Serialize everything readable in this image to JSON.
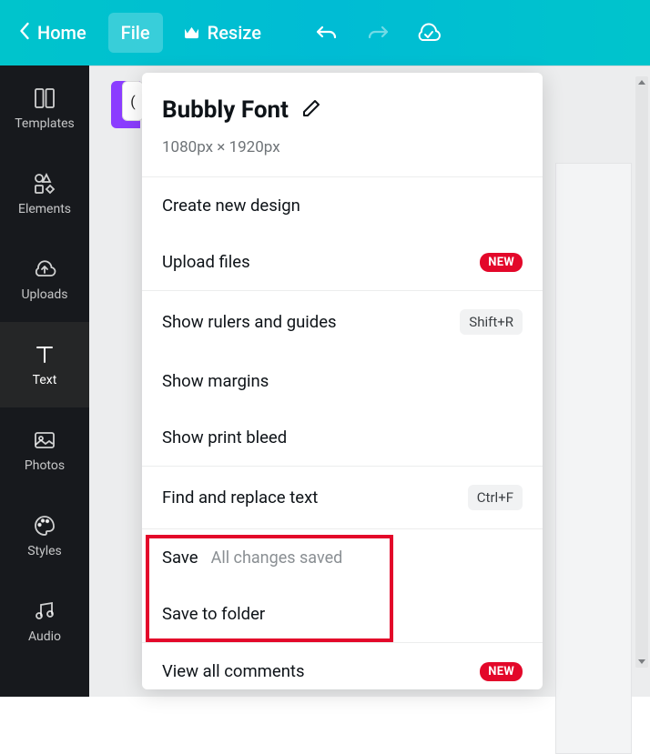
{
  "topbar": {
    "home": "Home",
    "file": "File",
    "resize": "Resize"
  },
  "sidebar": {
    "items": [
      {
        "label": "Templates"
      },
      {
        "label": "Elements"
      },
      {
        "label": "Uploads"
      },
      {
        "label": "Text"
      },
      {
        "label": "Photos"
      },
      {
        "label": "Styles"
      },
      {
        "label": "Audio"
      }
    ]
  },
  "file_menu": {
    "title": "Bubbly Font",
    "dimensions": "1080px × 1920px",
    "create_new": "Create new design",
    "upload_files": "Upload files",
    "show_rulers": "Show rulers and guides",
    "rulers_shortcut": "Shift+R",
    "show_margins": "Show margins",
    "show_bleed": "Show print bleed",
    "find_replace": "Find and replace text",
    "find_shortcut": "Ctrl+F",
    "save": "Save",
    "save_status": "All changes saved",
    "save_folder": "Save to folder",
    "view_comments": "View all comments",
    "badge_new": "NEW"
  }
}
